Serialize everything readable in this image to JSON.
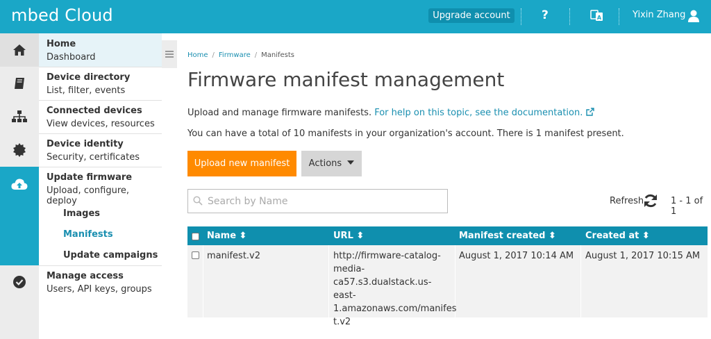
{
  "header": {
    "logo": "mbed Cloud",
    "upgrade_label": "Upgrade account",
    "help_label": "?",
    "user_name": "Yixin Zhang"
  },
  "sidebar": {
    "items": [
      {
        "title": "Home",
        "subtitle": "Dashboard",
        "icon": "home-icon"
      },
      {
        "title": "Device directory",
        "subtitle": "List, filter, events",
        "icon": "book-icon"
      },
      {
        "title": "Connected devices",
        "subtitle": "View devices, resources",
        "icon": "sitemap-icon"
      },
      {
        "title": "Device identity",
        "subtitle": "Security, certificates",
        "icon": "certificate-icon"
      },
      {
        "title": "Update firmware",
        "subtitle": "Upload, configure, deploy",
        "icon": "cloud-upload-icon"
      },
      {
        "title": "Manage access",
        "subtitle": "Users, API keys, groups",
        "icon": "check-circle-icon"
      }
    ],
    "subitems": [
      "Images",
      "Manifests",
      "Update campaigns"
    ],
    "active_subitem": "Manifests"
  },
  "breadcrumb": [
    "Home",
    "Firmware",
    "Manifests"
  ],
  "page": {
    "title": "Firmware manifest management",
    "description": "Upload and manage firmware manifests.",
    "help_link": "For help on this topic, see the documentation.",
    "count_text": "You can have a total of 10 manifests in your organization's account. There is 1 manifest present.",
    "upload_button": "Upload new manifest",
    "actions_button": "Actions",
    "search_placeholder": "Search by Name",
    "refresh_label": "Refresh",
    "paging": "1 - 1 of 1"
  },
  "table": {
    "columns": [
      "Name",
      "URL",
      "Manifest created",
      "Created at"
    ],
    "rows": [
      {
        "name": "manifest.v2",
        "url_lines": [
          "http://firmware-catalog-",
          "media-",
          "ca57.s3.dualstack.us-east-",
          "1.amazonaws.com/manifes",
          "t.v2"
        ],
        "manifest_created": "August 1, 2017 10:14 AM",
        "created_at": "August 1, 2017 10:15 AM"
      }
    ]
  },
  "colors": {
    "brand": "#1aa7c7",
    "table_header": "#0f8fae",
    "primary_button": "#ff8a00",
    "link": "#1a8fb0"
  }
}
